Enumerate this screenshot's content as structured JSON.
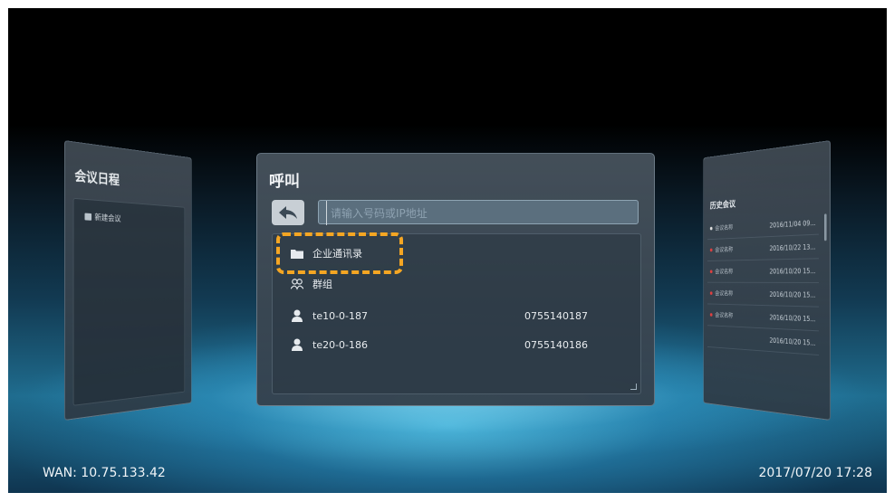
{
  "left_panel": {
    "title": "会议日程",
    "item_label": "新建会议"
  },
  "call_panel": {
    "title": "呼叫",
    "search_placeholder": "请输入号码或IP地址",
    "items": [
      {
        "label": "企业通讯录",
        "type": "directory"
      },
      {
        "label": "群组",
        "type": "group"
      },
      {
        "label": "te10-0-187",
        "number": "0755140187",
        "type": "contact"
      },
      {
        "label": "te20-0-186",
        "number": "0755140186",
        "type": "contact"
      }
    ]
  },
  "right_panel": {
    "title": "历史会议",
    "rows": [
      {
        "name": "会议名称",
        "date": "2016/11/04 09..."
      },
      {
        "name": "会议名称",
        "date": "2016/10/22 13..."
      },
      {
        "name": "会议名称",
        "date": "2016/10/20 15..."
      },
      {
        "name": "会议名称",
        "date": "2016/10/20 15..."
      },
      {
        "name": "会议名称",
        "date": "2016/10/20 15..."
      },
      {
        "name": "",
        "date": "2016/10/20 15..."
      }
    ]
  },
  "status": {
    "wan": "WAN: 10.75.133.42",
    "datetime": "2017/07/20 17:28"
  },
  "colors": {
    "highlight": "#f5a623",
    "accent": "#3aa7d8"
  }
}
